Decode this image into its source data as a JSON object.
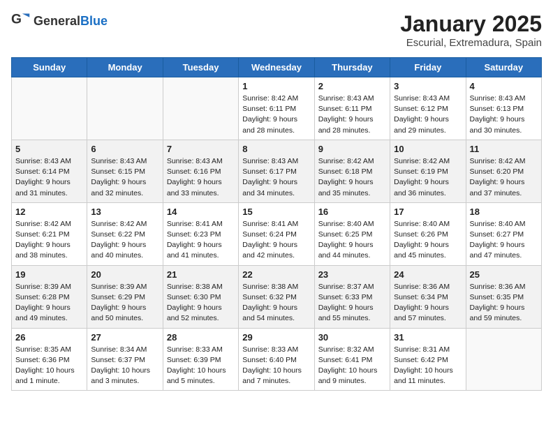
{
  "logo": {
    "general": "General",
    "blue": "Blue"
  },
  "title": "January 2025",
  "subtitle": "Escurial, Extremadura, Spain",
  "days_of_week": [
    "Sunday",
    "Monday",
    "Tuesday",
    "Wednesday",
    "Thursday",
    "Friday",
    "Saturday"
  ],
  "weeks": [
    {
      "shaded": false,
      "days": [
        {
          "num": "",
          "info": ""
        },
        {
          "num": "",
          "info": ""
        },
        {
          "num": "",
          "info": ""
        },
        {
          "num": "1",
          "info": "Sunrise: 8:42 AM\nSunset: 6:11 PM\nDaylight: 9 hours\nand 28 minutes."
        },
        {
          "num": "2",
          "info": "Sunrise: 8:43 AM\nSunset: 6:11 PM\nDaylight: 9 hours\nand 28 minutes."
        },
        {
          "num": "3",
          "info": "Sunrise: 8:43 AM\nSunset: 6:12 PM\nDaylight: 9 hours\nand 29 minutes."
        },
        {
          "num": "4",
          "info": "Sunrise: 8:43 AM\nSunset: 6:13 PM\nDaylight: 9 hours\nand 30 minutes."
        }
      ]
    },
    {
      "shaded": true,
      "days": [
        {
          "num": "5",
          "info": "Sunrise: 8:43 AM\nSunset: 6:14 PM\nDaylight: 9 hours\nand 31 minutes."
        },
        {
          "num": "6",
          "info": "Sunrise: 8:43 AM\nSunset: 6:15 PM\nDaylight: 9 hours\nand 32 minutes."
        },
        {
          "num": "7",
          "info": "Sunrise: 8:43 AM\nSunset: 6:16 PM\nDaylight: 9 hours\nand 33 minutes."
        },
        {
          "num": "8",
          "info": "Sunrise: 8:43 AM\nSunset: 6:17 PM\nDaylight: 9 hours\nand 34 minutes."
        },
        {
          "num": "9",
          "info": "Sunrise: 8:42 AM\nSunset: 6:18 PM\nDaylight: 9 hours\nand 35 minutes."
        },
        {
          "num": "10",
          "info": "Sunrise: 8:42 AM\nSunset: 6:19 PM\nDaylight: 9 hours\nand 36 minutes."
        },
        {
          "num": "11",
          "info": "Sunrise: 8:42 AM\nSunset: 6:20 PM\nDaylight: 9 hours\nand 37 minutes."
        }
      ]
    },
    {
      "shaded": false,
      "days": [
        {
          "num": "12",
          "info": "Sunrise: 8:42 AM\nSunset: 6:21 PM\nDaylight: 9 hours\nand 38 minutes."
        },
        {
          "num": "13",
          "info": "Sunrise: 8:42 AM\nSunset: 6:22 PM\nDaylight: 9 hours\nand 40 minutes."
        },
        {
          "num": "14",
          "info": "Sunrise: 8:41 AM\nSunset: 6:23 PM\nDaylight: 9 hours\nand 41 minutes."
        },
        {
          "num": "15",
          "info": "Sunrise: 8:41 AM\nSunset: 6:24 PM\nDaylight: 9 hours\nand 42 minutes."
        },
        {
          "num": "16",
          "info": "Sunrise: 8:40 AM\nSunset: 6:25 PM\nDaylight: 9 hours\nand 44 minutes."
        },
        {
          "num": "17",
          "info": "Sunrise: 8:40 AM\nSunset: 6:26 PM\nDaylight: 9 hours\nand 45 minutes."
        },
        {
          "num": "18",
          "info": "Sunrise: 8:40 AM\nSunset: 6:27 PM\nDaylight: 9 hours\nand 47 minutes."
        }
      ]
    },
    {
      "shaded": true,
      "days": [
        {
          "num": "19",
          "info": "Sunrise: 8:39 AM\nSunset: 6:28 PM\nDaylight: 9 hours\nand 49 minutes."
        },
        {
          "num": "20",
          "info": "Sunrise: 8:39 AM\nSunset: 6:29 PM\nDaylight: 9 hours\nand 50 minutes."
        },
        {
          "num": "21",
          "info": "Sunrise: 8:38 AM\nSunset: 6:30 PM\nDaylight: 9 hours\nand 52 minutes."
        },
        {
          "num": "22",
          "info": "Sunrise: 8:38 AM\nSunset: 6:32 PM\nDaylight: 9 hours\nand 54 minutes."
        },
        {
          "num": "23",
          "info": "Sunrise: 8:37 AM\nSunset: 6:33 PM\nDaylight: 9 hours\nand 55 minutes."
        },
        {
          "num": "24",
          "info": "Sunrise: 8:36 AM\nSunset: 6:34 PM\nDaylight: 9 hours\nand 57 minutes."
        },
        {
          "num": "25",
          "info": "Sunrise: 8:36 AM\nSunset: 6:35 PM\nDaylight: 9 hours\nand 59 minutes."
        }
      ]
    },
    {
      "shaded": false,
      "days": [
        {
          "num": "26",
          "info": "Sunrise: 8:35 AM\nSunset: 6:36 PM\nDaylight: 10 hours\nand 1 minute."
        },
        {
          "num": "27",
          "info": "Sunrise: 8:34 AM\nSunset: 6:37 PM\nDaylight: 10 hours\nand 3 minutes."
        },
        {
          "num": "28",
          "info": "Sunrise: 8:33 AM\nSunset: 6:39 PM\nDaylight: 10 hours\nand 5 minutes."
        },
        {
          "num": "29",
          "info": "Sunrise: 8:33 AM\nSunset: 6:40 PM\nDaylight: 10 hours\nand 7 minutes."
        },
        {
          "num": "30",
          "info": "Sunrise: 8:32 AM\nSunset: 6:41 PM\nDaylight: 10 hours\nand 9 minutes."
        },
        {
          "num": "31",
          "info": "Sunrise: 8:31 AM\nSunset: 6:42 PM\nDaylight: 10 hours\nand 11 minutes."
        },
        {
          "num": "",
          "info": ""
        }
      ]
    }
  ]
}
